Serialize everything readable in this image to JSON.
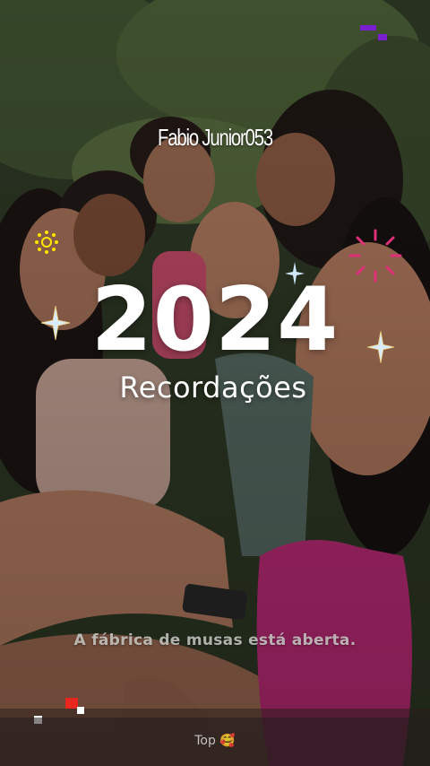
{
  "video": {
    "watermark": "Fabio Junior053",
    "year": "2024",
    "subtitle": "Recordações",
    "caption": "A fábrica de musas está aberta."
  },
  "bottom_bar": {
    "label": "Top",
    "emoji": "🥰"
  },
  "colors": {
    "text": "#ffffff",
    "sparkle": "#cfe8ff",
    "firework": "#e0307a",
    "accent_red": "#e8281e",
    "accent_purple": "#7a1fd0",
    "sun_yellow": "#ffe600"
  },
  "icons": [
    "sparkle-icon",
    "sun-icon",
    "firework-icon",
    "pixel-decoration-icon"
  ]
}
